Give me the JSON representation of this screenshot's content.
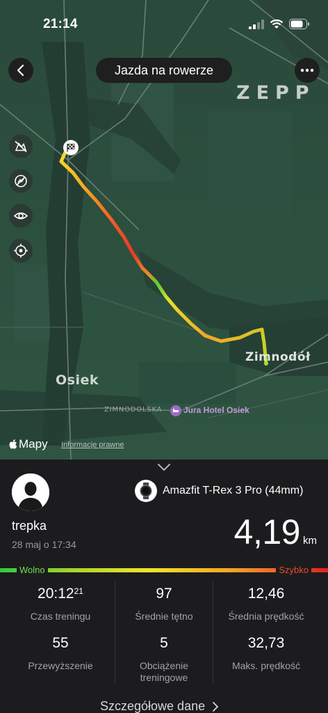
{
  "status_bar": {
    "time": "21:14"
  },
  "header": {
    "title": "Jazda na rowerze",
    "brand": "ZEPP"
  },
  "map": {
    "labels": {
      "town_left": "Osiek",
      "town_right": "Zimnodół",
      "street": "ZIMNODOLSKA",
      "poi": "Jura Hotel Osiek"
    },
    "tools": [
      "satellite-off-icon",
      "no-drop-icon",
      "eye-icon",
      "locate-icon"
    ],
    "provider": "Mapy",
    "legal": "Informacje prawne"
  },
  "workout": {
    "user_name": "trepka",
    "date": "28 maj o 17:34",
    "device": "Amazfit T-Rex 3 Pro (44mm)",
    "distance_value": "4,19",
    "distance_unit": "km",
    "speed_legend": {
      "slow": "Wolno",
      "fast": "Szybko"
    },
    "stats": [
      {
        "value": "20:12",
        "value_suffix": "21",
        "label": "Czas treningu"
      },
      {
        "value": "97",
        "label": "Średnie tętno"
      },
      {
        "value": "12,46",
        "label": "Średnia prędkość"
      },
      {
        "value": "55",
        "label": "Przewyższenie"
      },
      {
        "value": "5",
        "label": "Obciążenie treningowe"
      },
      {
        "value": "32,73",
        "label": "Maks. prędkość"
      }
    ],
    "details_link": "Szczegółowe dane"
  },
  "colors": {
    "map_bg": "#2d4f3f",
    "panel_bg": "#1c1c1e",
    "slow": "#2ecc40",
    "fast": "#e02020"
  }
}
